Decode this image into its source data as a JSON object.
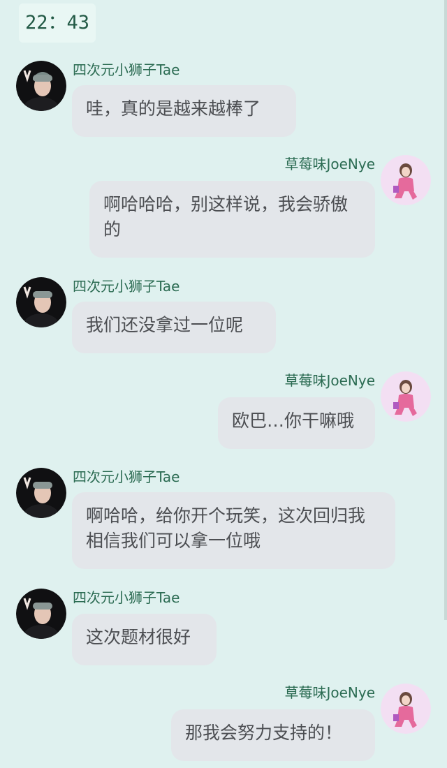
{
  "status": {
    "time": "22：43"
  },
  "users": {
    "tae": {
      "name": "四次元小狮子Tae"
    },
    "joenye": {
      "name": "草莓味JoeNye"
    }
  },
  "messages": [
    {
      "sender": "tae",
      "text": "哇，真的是越来越棒了"
    },
    {
      "sender": "joenye",
      "text": "啊哈哈哈，别这样说，我会骄傲的"
    },
    {
      "sender": "tae",
      "text": "我们还没拿过一位呢"
    },
    {
      "sender": "joenye",
      "text": "欧巴…你干嘛哦"
    },
    {
      "sender": "tae",
      "text": "啊哈哈，给你开个玩笑，这次回归我相信我们可以拿一位哦"
    },
    {
      "sender": "tae",
      "text": "这次题材很好"
    },
    {
      "sender": "joenye",
      "text": "那我会努力支持的！"
    }
  ],
  "icons": {
    "tae_avatar": "avatar-photo-dark",
    "joenye_avatar": "avatar-illustration-pink"
  }
}
